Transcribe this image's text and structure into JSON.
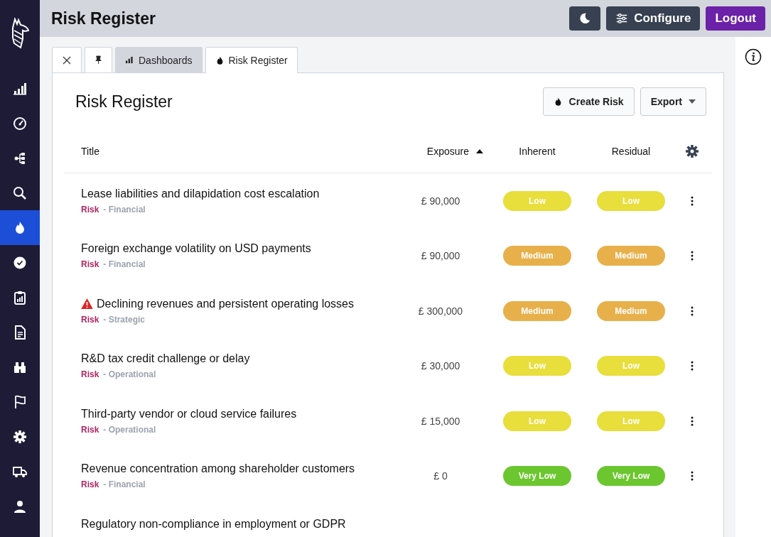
{
  "header": {
    "title": "Risk Register",
    "buttons": [
      {
        "kind": "theme"
      },
      {
        "kind": "configure",
        "label": "Configure"
      },
      {
        "kind": "logout",
        "label": "Logout"
      }
    ]
  },
  "sidebar": {
    "items": [
      {
        "selected": false
      },
      {
        "selected": false
      },
      {
        "selected": false
      },
      {
        "selected": false
      },
      {
        "selected": true
      },
      {
        "selected": false
      },
      {
        "selected": false
      },
      {
        "selected": false
      },
      {
        "selected": false
      },
      {
        "selected": false
      },
      {
        "selected": false
      },
      {
        "selected": false
      },
      {
        "selected": false
      }
    ]
  },
  "tabs": [
    {
      "kind": "close",
      "selected": false
    },
    {
      "kind": "pin",
      "selected": false
    },
    {
      "kind": "dashboards",
      "label": "Dashboards",
      "selected": false
    },
    {
      "kind": "risk",
      "label": "Risk Register",
      "selected": true
    }
  ],
  "card": {
    "title": "Risk Register",
    "buttons": [
      {
        "kind": "create",
        "label": "Create Risk"
      },
      {
        "kind": "export",
        "label": "Export"
      }
    ]
  },
  "table": {
    "columns": [
      {
        "label": "Title",
        "sorted": false
      },
      {
        "label": "Exposure",
        "sorted": true
      },
      {
        "label": "Inherent",
        "sorted": false
      },
      {
        "label": "Residual",
        "sorted": false
      }
    ],
    "rows": [
      {
        "title": "Lease liabilities and dilapidation cost escalation",
        "warning": false,
        "type": "Risk",
        "category": "- Financial",
        "exposure": "£ 90,000",
        "inherent": {
          "label": "Low",
          "kind": "low"
        },
        "residual": {
          "label": "Low",
          "kind": "low"
        }
      },
      {
        "title": "Foreign exchange volatility on USD payments",
        "warning": false,
        "type": "Risk",
        "category": "- Financial",
        "exposure": "£ 90,000",
        "inherent": {
          "label": "Medium",
          "kind": "medium"
        },
        "residual": {
          "label": "Medium",
          "kind": "medium"
        }
      },
      {
        "title": "Declining revenues and persistent operating losses",
        "warning": true,
        "type": "Risk",
        "category": "- Strategic",
        "exposure": "£ 300,000",
        "inherent": {
          "label": "Medium",
          "kind": "medium"
        },
        "residual": {
          "label": "Medium",
          "kind": "medium"
        }
      },
      {
        "title": "R&D tax credit challenge or delay",
        "warning": false,
        "type": "Risk",
        "category": "- Operational",
        "exposure": "£ 30,000",
        "inherent": {
          "label": "Low",
          "kind": "low"
        },
        "residual": {
          "label": "Low",
          "kind": "low"
        }
      },
      {
        "title": "Third-party vendor or cloud service failures",
        "warning": false,
        "type": "Risk",
        "category": "- Operational",
        "exposure": "£ 15,000",
        "inherent": {
          "label": "Low",
          "kind": "low"
        },
        "residual": {
          "label": "Low",
          "kind": "low"
        }
      },
      {
        "title": "Revenue concentration among shareholder customers",
        "warning": false,
        "type": "Risk",
        "category": "- Financial",
        "exposure": "£ 0",
        "inherent": {
          "label": "Very Low",
          "kind": "very-low"
        },
        "residual": {
          "label": "Very Low",
          "kind": "very-low"
        }
      },
      {
        "title": "Regulatory non-compliance in employment or GDPR"
      }
    ]
  }
}
